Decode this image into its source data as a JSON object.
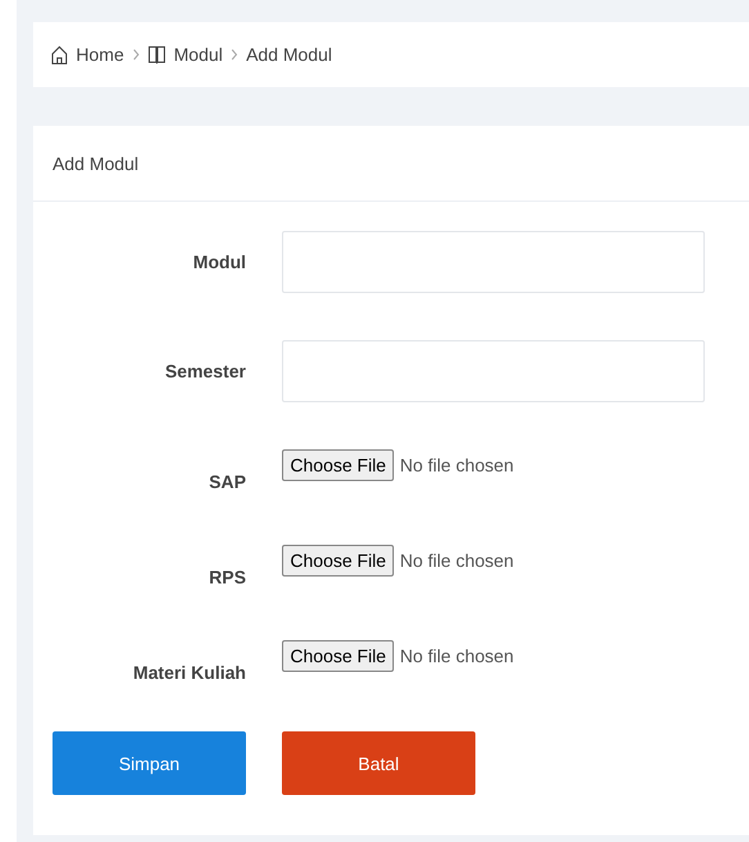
{
  "breadcrumb": [
    {
      "label": "Home",
      "kind": "home"
    },
    {
      "label": "Modul",
      "kind": "book"
    },
    {
      "label": "Add Modul",
      "kind": "current"
    }
  ],
  "card": {
    "title": "Add Modul"
  },
  "fields": [
    {
      "label": "Modul",
      "kind": "text"
    },
    {
      "label": "Semester",
      "kind": "text"
    },
    {
      "label": "SAP",
      "kind": "file",
      "button": "Choose File",
      "status": "No file chosen"
    },
    {
      "label": "RPS",
      "kind": "file",
      "button": "Choose File",
      "status": "No file chosen"
    },
    {
      "label": "Materi Kuliah",
      "kind": "file",
      "button": "Choose File",
      "status": "No file chosen"
    }
  ],
  "buttons": [
    {
      "label": "Simpan",
      "kind": "primary"
    },
    {
      "label": "Batal",
      "kind": "danger"
    }
  ]
}
